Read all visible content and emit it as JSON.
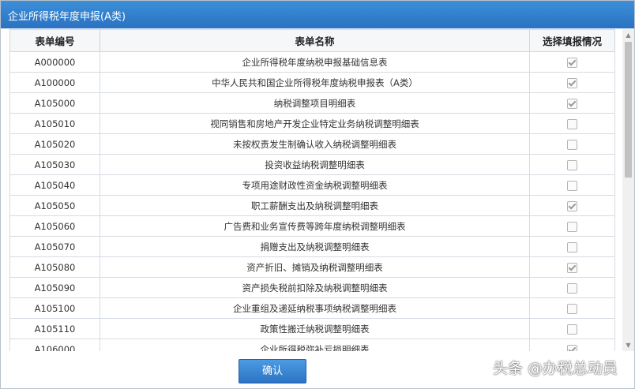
{
  "dialog": {
    "title": "企业所得税年度申报(A类)"
  },
  "table": {
    "headers": [
      "表单编号",
      "表单名称",
      "选择填报情况"
    ],
    "rows": [
      {
        "code": "A000000",
        "name": "企业所得税年度纳税申报基础信息表",
        "checked": true
      },
      {
        "code": "A100000",
        "name": "中华人民共和国企业所得税年度纳税申报表（A类）",
        "checked": true
      },
      {
        "code": "A105000",
        "name": "纳税调整项目明细表",
        "checked": true
      },
      {
        "code": "A105010",
        "name": "视同销售和房地产开发企业特定业务纳税调整明细表",
        "checked": false
      },
      {
        "code": "A105020",
        "name": "未按权责发生制确认收入纳税调整明细表",
        "checked": false
      },
      {
        "code": "A105030",
        "name": "投资收益纳税调整明细表",
        "checked": false
      },
      {
        "code": "A105040",
        "name": "专项用途财政性资金纳税调整明细表",
        "checked": false
      },
      {
        "code": "A105050",
        "name": "职工薪酬支出及纳税调整明细表",
        "checked": true
      },
      {
        "code": "A105060",
        "name": "广告费和业务宣传费等跨年度纳税调整明细表",
        "checked": false
      },
      {
        "code": "A105070",
        "name": "捐赠支出及纳税调整明细表",
        "checked": false
      },
      {
        "code": "A105080",
        "name": "资产折旧、摊销及纳税调整明细表",
        "checked": true
      },
      {
        "code": "A105090",
        "name": "资产损失税前扣除及纳税调整明细表",
        "checked": false
      },
      {
        "code": "A105100",
        "name": "企业重组及递延纳税事项纳税调整明细表",
        "checked": false
      },
      {
        "code": "A105110",
        "name": "政策性搬迁纳税调整明细表",
        "checked": false
      },
      {
        "code": "A106000",
        "name": "企业所得税弥补亏损明细表",
        "checked": true
      }
    ]
  },
  "footer": {
    "confirm_label": "确认"
  },
  "watermark": {
    "text": "头条 @办税总动员"
  }
}
